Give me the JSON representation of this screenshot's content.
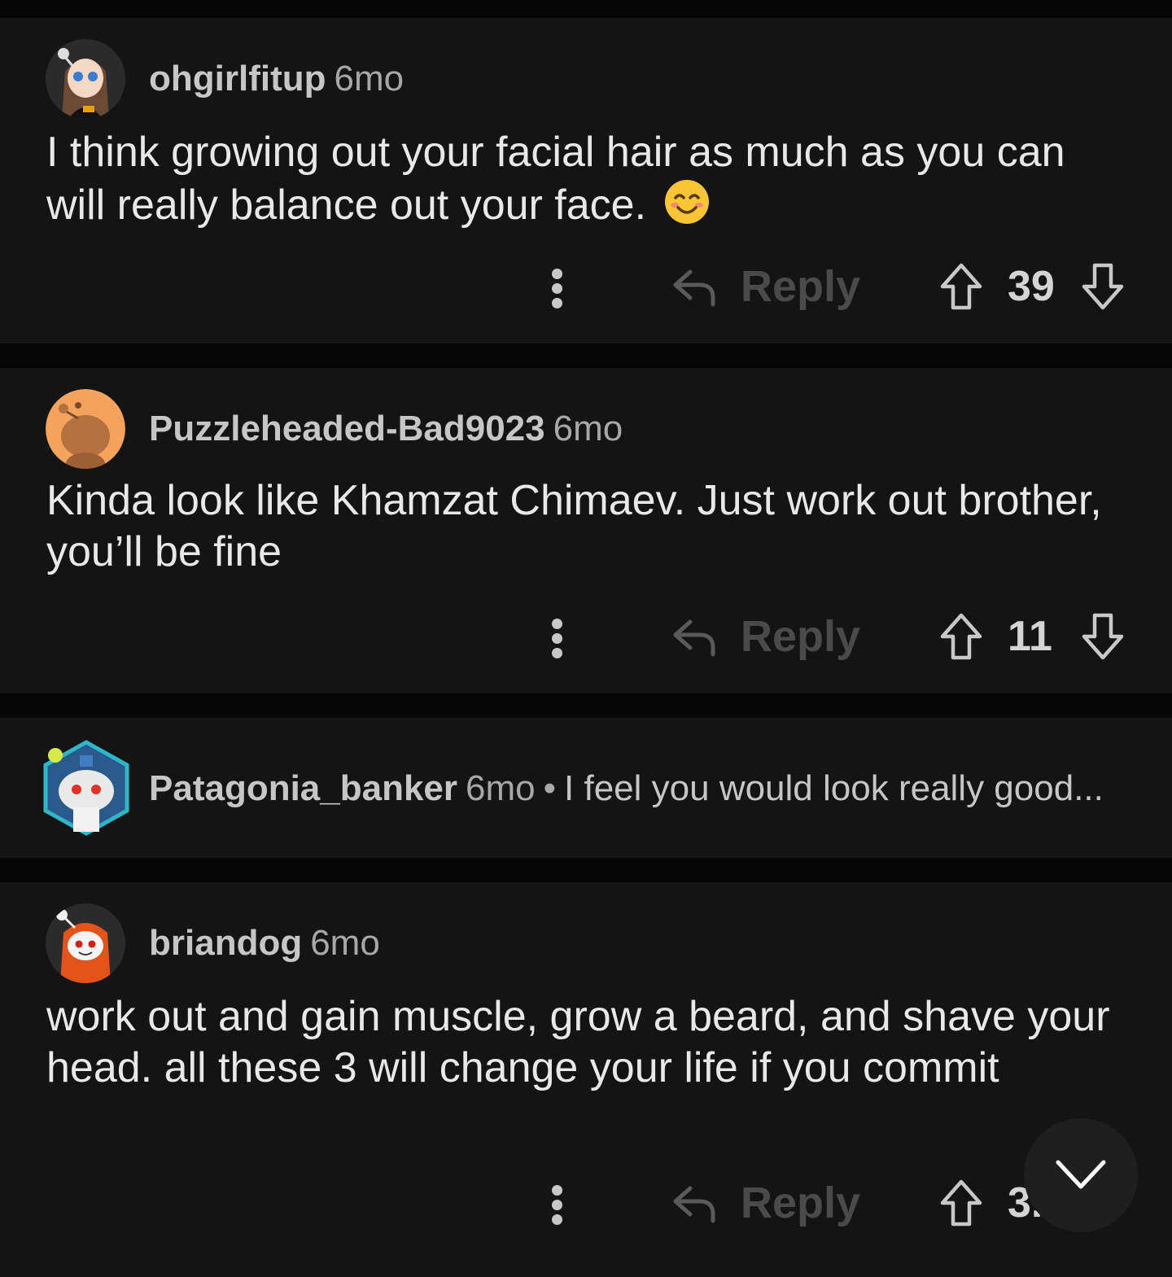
{
  "comments": [
    {
      "username": "ohgirlfitup",
      "age": "6mo",
      "body": "I think growing out your facial hair as much as you can will really balance out your face.",
      "emoji": "smiling-face-emoji",
      "reply_label": "Reply",
      "votes": "39"
    },
    {
      "username": "Puzzleheaded-Bad9023",
      "age": "6mo",
      "body": "Kinda look like Khamzat Chimaev. Just work out brother, you’ll be fine",
      "reply_label": "Reply",
      "votes": "11"
    },
    {
      "username": "Patagonia_banker",
      "age": "6mo",
      "separator": "•",
      "preview": "I feel you would look really good...",
      "collapsed": true
    },
    {
      "username": "briandog",
      "age": "6mo",
      "body": "work out and gain muscle, grow a beard, and shave your head. all these 3 will change your life if you commit",
      "reply_label": "Reply",
      "votes": "3."
    }
  ],
  "icons": {
    "more": "more-vertical-icon",
    "reply": "reply-arrow-icon",
    "upvote": "upvote-arrow-icon",
    "downvote": "downvote-arrow-icon",
    "scroll": "chevron-down-icon"
  },
  "colors": {
    "background": "#050505",
    "card": "#141414",
    "username": "#c6c6c6",
    "reply_label": "#4a4a4a"
  }
}
